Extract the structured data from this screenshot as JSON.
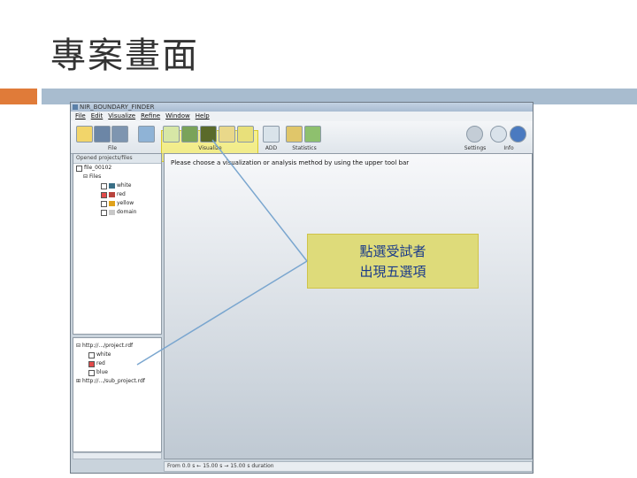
{
  "slide": {
    "title": "專案畫面"
  },
  "window": {
    "title": "NIR_BOUNDARY_FINDER"
  },
  "menu": [
    "File",
    "Edit",
    "Visualize",
    "Refine",
    "Window",
    "Help"
  ],
  "toolbar": {
    "groups": [
      {
        "label": "File"
      },
      {
        "label": "Visualize"
      },
      {
        "label": "ADD"
      },
      {
        "label": "Statistics"
      },
      {
        "label": "Settings"
      },
      {
        "label": "Info"
      }
    ]
  },
  "left_panel": {
    "header": "Opened projects/files",
    "tree": [
      {
        "label": "file_00102",
        "level": 0
      },
      {
        "label": "Files",
        "level": 1
      },
      {
        "label": "white",
        "level": 2,
        "checked": false,
        "color": "#3a6f86"
      },
      {
        "label": "red",
        "level": 2,
        "checked": true,
        "color": "#b8433d"
      },
      {
        "label": "yellow",
        "level": 2,
        "checked": false,
        "color": "#e0a21b"
      },
      {
        "label": "domain",
        "level": 2,
        "checked": false,
        "color": "#c8c8c8"
      }
    ]
  },
  "lower_panel": {
    "tree": [
      {
        "label": "http://.../project.rdf",
        "level": 0
      },
      {
        "label": "white",
        "level": 1,
        "checked": false
      },
      {
        "label": "red",
        "level": 1,
        "checked": true
      },
      {
        "label": "blue",
        "level": 1,
        "checked": false
      },
      {
        "label": "http://.../sub_project.rdf",
        "level": 0
      }
    ]
  },
  "main": {
    "instruction": "Please choose a visualization or analysis method by using the upper tool bar"
  },
  "status": {
    "text": "From 0.0 s   ← 15.00 s  →  15.00 s duration"
  },
  "callout": {
    "line1": "點選受試者",
    "line2": "出現五選項"
  },
  "colors": {
    "accent_orange": "#e07b39",
    "accent_blue": "#a8bccf",
    "callout_bg": "#dedb7a",
    "callout_text": "#1a3a8a",
    "arrow": "#7aa6cf"
  }
}
